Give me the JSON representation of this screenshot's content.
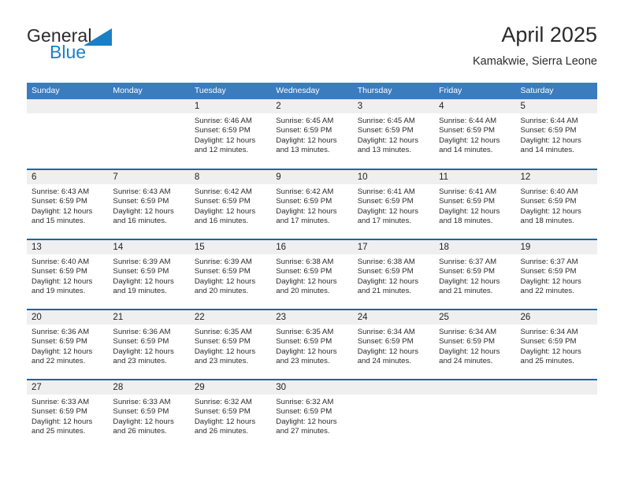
{
  "brand": {
    "name_part1": "General",
    "name_part2": "Blue",
    "logo_color": "#1C7FC4"
  },
  "header": {
    "title": "April 2025",
    "subtitle": "Kamakwie, Sierra Leone"
  },
  "theme": {
    "header_blue": "#3B7CBE",
    "row_divider_blue": "#1F64A8",
    "daynum_band": "#EFEFEF"
  },
  "calendar": {
    "weekday_headers": [
      "Sunday",
      "Monday",
      "Tuesday",
      "Wednesday",
      "Thursday",
      "Friday",
      "Saturday"
    ],
    "labels": {
      "sunrise": "Sunrise:",
      "sunset": "Sunset:",
      "daylight": "Daylight:"
    },
    "weeks": [
      [
        {
          "day": "",
          "empty": true
        },
        {
          "day": "",
          "empty": true
        },
        {
          "day": "1",
          "sunrise": "Sunrise: 6:46 AM",
          "sunset": "Sunset: 6:59 PM",
          "daylight_line1": "Daylight: 12 hours",
          "daylight_line2": "and 12 minutes."
        },
        {
          "day": "2",
          "sunrise": "Sunrise: 6:45 AM",
          "sunset": "Sunset: 6:59 PM",
          "daylight_line1": "Daylight: 12 hours",
          "daylight_line2": "and 13 minutes."
        },
        {
          "day": "3",
          "sunrise": "Sunrise: 6:45 AM",
          "sunset": "Sunset: 6:59 PM",
          "daylight_line1": "Daylight: 12 hours",
          "daylight_line2": "and 13 minutes."
        },
        {
          "day": "4",
          "sunrise": "Sunrise: 6:44 AM",
          "sunset": "Sunset: 6:59 PM",
          "daylight_line1": "Daylight: 12 hours",
          "daylight_line2": "and 14 minutes."
        },
        {
          "day": "5",
          "sunrise": "Sunrise: 6:44 AM",
          "sunset": "Sunset: 6:59 PM",
          "daylight_line1": "Daylight: 12 hours",
          "daylight_line2": "and 14 minutes."
        }
      ],
      [
        {
          "day": "6",
          "sunrise": "Sunrise: 6:43 AM",
          "sunset": "Sunset: 6:59 PM",
          "daylight_line1": "Daylight: 12 hours",
          "daylight_line2": "and 15 minutes."
        },
        {
          "day": "7",
          "sunrise": "Sunrise: 6:43 AM",
          "sunset": "Sunset: 6:59 PM",
          "daylight_line1": "Daylight: 12 hours",
          "daylight_line2": "and 16 minutes."
        },
        {
          "day": "8",
          "sunrise": "Sunrise: 6:42 AM",
          "sunset": "Sunset: 6:59 PM",
          "daylight_line1": "Daylight: 12 hours",
          "daylight_line2": "and 16 minutes."
        },
        {
          "day": "9",
          "sunrise": "Sunrise: 6:42 AM",
          "sunset": "Sunset: 6:59 PM",
          "daylight_line1": "Daylight: 12 hours",
          "daylight_line2": "and 17 minutes."
        },
        {
          "day": "10",
          "sunrise": "Sunrise: 6:41 AM",
          "sunset": "Sunset: 6:59 PM",
          "daylight_line1": "Daylight: 12 hours",
          "daylight_line2": "and 17 minutes."
        },
        {
          "day": "11",
          "sunrise": "Sunrise: 6:41 AM",
          "sunset": "Sunset: 6:59 PM",
          "daylight_line1": "Daylight: 12 hours",
          "daylight_line2": "and 18 minutes."
        },
        {
          "day": "12",
          "sunrise": "Sunrise: 6:40 AM",
          "sunset": "Sunset: 6:59 PM",
          "daylight_line1": "Daylight: 12 hours",
          "daylight_line2": "and 18 minutes."
        }
      ],
      [
        {
          "day": "13",
          "sunrise": "Sunrise: 6:40 AM",
          "sunset": "Sunset: 6:59 PM",
          "daylight_line1": "Daylight: 12 hours",
          "daylight_line2": "and 19 minutes."
        },
        {
          "day": "14",
          "sunrise": "Sunrise: 6:39 AM",
          "sunset": "Sunset: 6:59 PM",
          "daylight_line1": "Daylight: 12 hours",
          "daylight_line2": "and 19 minutes."
        },
        {
          "day": "15",
          "sunrise": "Sunrise: 6:39 AM",
          "sunset": "Sunset: 6:59 PM",
          "daylight_line1": "Daylight: 12 hours",
          "daylight_line2": "and 20 minutes."
        },
        {
          "day": "16",
          "sunrise": "Sunrise: 6:38 AM",
          "sunset": "Sunset: 6:59 PM",
          "daylight_line1": "Daylight: 12 hours",
          "daylight_line2": "and 20 minutes."
        },
        {
          "day": "17",
          "sunrise": "Sunrise: 6:38 AM",
          "sunset": "Sunset: 6:59 PM",
          "daylight_line1": "Daylight: 12 hours",
          "daylight_line2": "and 21 minutes."
        },
        {
          "day": "18",
          "sunrise": "Sunrise: 6:37 AM",
          "sunset": "Sunset: 6:59 PM",
          "daylight_line1": "Daylight: 12 hours",
          "daylight_line2": "and 21 minutes."
        },
        {
          "day": "19",
          "sunrise": "Sunrise: 6:37 AM",
          "sunset": "Sunset: 6:59 PM",
          "daylight_line1": "Daylight: 12 hours",
          "daylight_line2": "and 22 minutes."
        }
      ],
      [
        {
          "day": "20",
          "sunrise": "Sunrise: 6:36 AM",
          "sunset": "Sunset: 6:59 PM",
          "daylight_line1": "Daylight: 12 hours",
          "daylight_line2": "and 22 minutes."
        },
        {
          "day": "21",
          "sunrise": "Sunrise: 6:36 AM",
          "sunset": "Sunset: 6:59 PM",
          "daylight_line1": "Daylight: 12 hours",
          "daylight_line2": "and 23 minutes."
        },
        {
          "day": "22",
          "sunrise": "Sunrise: 6:35 AM",
          "sunset": "Sunset: 6:59 PM",
          "daylight_line1": "Daylight: 12 hours",
          "daylight_line2": "and 23 minutes."
        },
        {
          "day": "23",
          "sunrise": "Sunrise: 6:35 AM",
          "sunset": "Sunset: 6:59 PM",
          "daylight_line1": "Daylight: 12 hours",
          "daylight_line2": "and 23 minutes."
        },
        {
          "day": "24",
          "sunrise": "Sunrise: 6:34 AM",
          "sunset": "Sunset: 6:59 PM",
          "daylight_line1": "Daylight: 12 hours",
          "daylight_line2": "and 24 minutes."
        },
        {
          "day": "25",
          "sunrise": "Sunrise: 6:34 AM",
          "sunset": "Sunset: 6:59 PM",
          "daylight_line1": "Daylight: 12 hours",
          "daylight_line2": "and 24 minutes."
        },
        {
          "day": "26",
          "sunrise": "Sunrise: 6:34 AM",
          "sunset": "Sunset: 6:59 PM",
          "daylight_line1": "Daylight: 12 hours",
          "daylight_line2": "and 25 minutes."
        }
      ],
      [
        {
          "day": "27",
          "sunrise": "Sunrise: 6:33 AM",
          "sunset": "Sunset: 6:59 PM",
          "daylight_line1": "Daylight: 12 hours",
          "daylight_line2": "and 25 minutes."
        },
        {
          "day": "28",
          "sunrise": "Sunrise: 6:33 AM",
          "sunset": "Sunset: 6:59 PM",
          "daylight_line1": "Daylight: 12 hours",
          "daylight_line2": "and 26 minutes."
        },
        {
          "day": "29",
          "sunrise": "Sunrise: 6:32 AM",
          "sunset": "Sunset: 6:59 PM",
          "daylight_line1": "Daylight: 12 hours",
          "daylight_line2": "and 26 minutes."
        },
        {
          "day": "30",
          "sunrise": "Sunrise: 6:32 AM",
          "sunset": "Sunset: 6:59 PM",
          "daylight_line1": "Daylight: 12 hours",
          "daylight_line2": "and 27 minutes."
        },
        {
          "day": "",
          "empty": true
        },
        {
          "day": "",
          "empty": true
        },
        {
          "day": "",
          "empty": true
        }
      ]
    ]
  }
}
